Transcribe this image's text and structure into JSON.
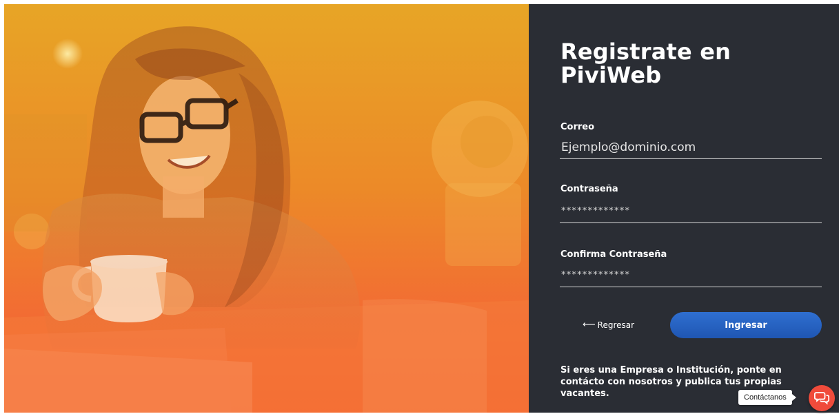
{
  "hero": {
    "image": "woman-with-glasses-holding-coffee-cup-photo",
    "overlay_colors": [
      "#e7a526",
      "#f26d33"
    ]
  },
  "form": {
    "title": "Registrate en PiviWeb",
    "email": {
      "label": "Correo",
      "placeholder": "Ejemplo@dominio.com"
    },
    "password": {
      "label": "Contraseña",
      "value": "*************"
    },
    "confirm_password": {
      "label": "Confirma Contraseña",
      "value": "*************"
    },
    "back_label": "Regresar",
    "back_icon": "arrow-left-icon",
    "submit_label": "Ingresar",
    "submit_color": "#2563c4",
    "info_text": "Si eres una Empresa o Institución, ponte en contácto con nosotros y publica tus propias vacantes."
  },
  "contact": {
    "tooltip": "Contáctanos",
    "icon": "chat-bubbles-icon",
    "color": "#f04b3b"
  },
  "colors": {
    "panel_bg": "#2a2d34"
  }
}
